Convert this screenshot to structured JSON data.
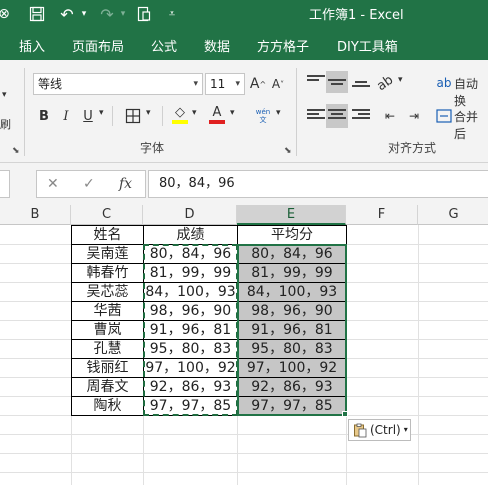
{
  "title_bar": {
    "title": "工作簿1 - Excel",
    "background": "#217346"
  },
  "ribbon_tabs": [
    "插入",
    "页面布局",
    "公式",
    "数据",
    "方方格子",
    "DIY工具箱"
  ],
  "ribbon": {
    "font_name": "等线",
    "font_size": "11",
    "grow_font": "A^",
    "shrink_font": "A˅",
    "bold": "B",
    "italic": "I",
    "underline": "U",
    "phonetic": "wén 文",
    "font_group_label": "字体",
    "align_group_label": "对齐方式",
    "wrap_text": "自动换",
    "merge_center": "合并后"
  },
  "formula_bar": {
    "fx": "fx",
    "value": "80，84，96"
  },
  "columns": [
    "B",
    "C",
    "D",
    "E",
    "F",
    "G"
  ],
  "active_column": "E",
  "table": {
    "headers": [
      "姓名",
      "成绩",
      "平均分"
    ],
    "rows": [
      [
        "吴南莲",
        "80，84，96",
        "80，84，96"
      ],
      [
        "韩春竹",
        "81，99，99",
        "81，99，99"
      ],
      [
        "吴芯蕊",
        "84，100，93",
        "84，100，93"
      ],
      [
        "华茜",
        "98，96，90",
        "98，96，90"
      ],
      [
        "曹岚",
        "91，96，81",
        "91，96，81"
      ],
      [
        "孔慧",
        "95，80，83",
        "95，80，83"
      ],
      [
        "钱丽红",
        "97，100，92",
        "97，100，92"
      ],
      [
        "周春文",
        "92，86，93",
        "92，86，93"
      ],
      [
        "陶秋",
        "97，97，85",
        "97，97，85"
      ]
    ]
  },
  "paste_options": {
    "label": "(Ctrl)"
  }
}
